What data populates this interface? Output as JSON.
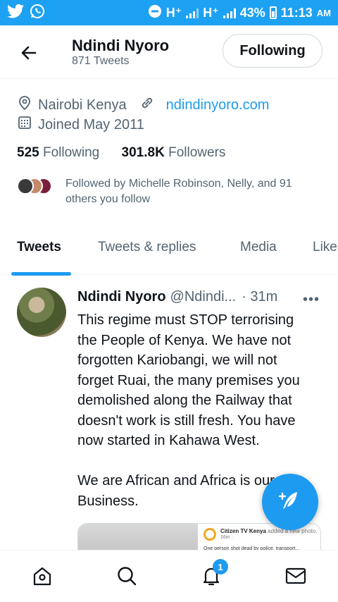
{
  "status_bar": {
    "network1": "H⁺",
    "network2": "H⁺",
    "battery": "43%",
    "time": "11:13",
    "ampm": "AM",
    "icons": [
      "twitter-icon",
      "whatsapp-icon",
      "do-not-disturb-icon",
      "signal-icon",
      "battery-icon"
    ]
  },
  "header": {
    "name": "Ndindi Nyoro",
    "tweet_count": "871 Tweets",
    "follow_button": "Following"
  },
  "profile": {
    "location": "Nairobi Kenya",
    "website": "ndindinyoro.com",
    "joined": "Joined May 2011",
    "following_count": "525",
    "following_label": "Following",
    "followers_count": "301.8K",
    "followers_label": "Followers",
    "followed_by": "Followed by Michelle Robinson, Nelly, and 91 others you follow"
  },
  "tabs": [
    {
      "label": "Tweets",
      "active": true
    },
    {
      "label": "Tweets & replies",
      "active": false
    },
    {
      "label": "Media",
      "active": false
    },
    {
      "label": "Likes",
      "active": false
    }
  ],
  "tweet": {
    "author": "Ndindi Nyoro",
    "handle": "@Ndindi...",
    "time": "· 31m",
    "more": "•••",
    "text": "This regime must STOP terrorising the People of Kenya. We have not forgotten Kariobangi, we will not forget Ruai, the many premises you demolished along the Railway that doesn't work is still fresh. You have now started in Kahawa West.\n\nWe are African and Africa is our Business.",
    "card": {
      "source": "Citizen TV Kenya",
      "note": "added a new photo.",
      "meta": "16m ·",
      "snippet": "One person shot dead by police, transport..."
    }
  },
  "bottom_nav": {
    "notifications_badge": "1"
  },
  "colors": {
    "brand": "#1da1f2",
    "link": "#1d9bf0",
    "secondary_text": "#536471"
  }
}
